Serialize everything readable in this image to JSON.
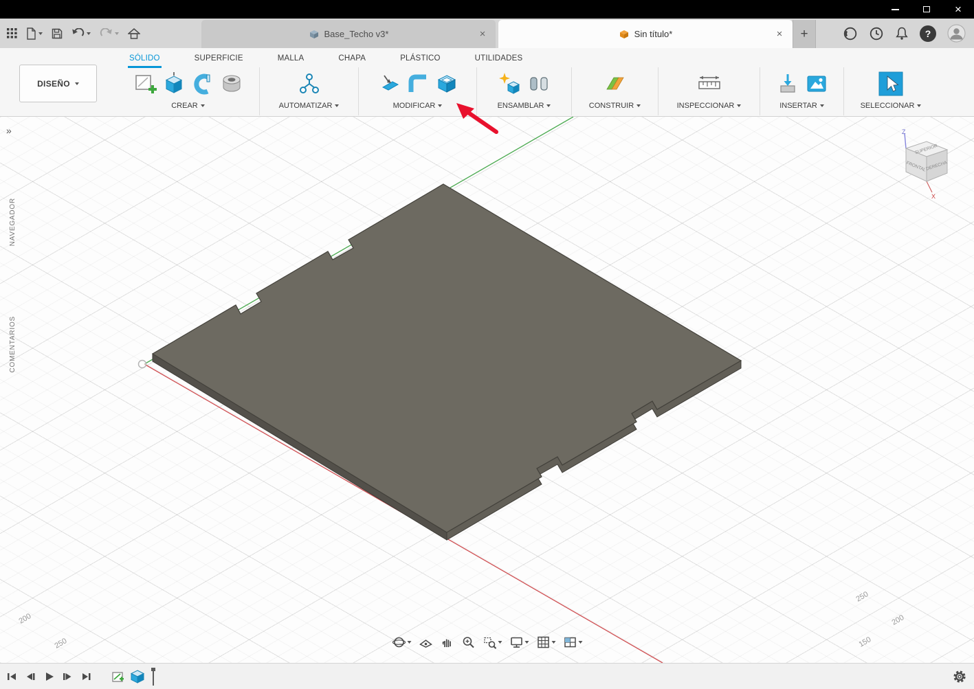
{
  "titlebar": {
    "close_icon": "×"
  },
  "tabstrip": {
    "documents": [
      {
        "label": "Base_Techo v3*",
        "active": false
      },
      {
        "label": "Sin título*",
        "active": true
      }
    ],
    "new_tab_label": "+",
    "close_tab_icon": "×"
  },
  "header_icons": {
    "help_glyph": "?"
  },
  "ribbon": {
    "workspace": {
      "label": "DISEÑO"
    },
    "env_tabs": [
      {
        "label": "SÓLIDO",
        "active": true
      },
      {
        "label": "SUPERFICIE",
        "active": false
      },
      {
        "label": "MALLA",
        "active": false
      },
      {
        "label": "CHAPA",
        "active": false
      },
      {
        "label": "PLÁSTICO",
        "active": false
      },
      {
        "label": "UTILIDADES",
        "active": false
      }
    ],
    "groups": [
      {
        "label": "CREAR"
      },
      {
        "label": "AUTOMATIZAR"
      },
      {
        "label": "MODIFICAR"
      },
      {
        "label": "ENSAMBLAR"
      },
      {
        "label": "CONSTRUIR"
      },
      {
        "label": "INSPECCIONAR"
      },
      {
        "label": "INSERTAR"
      },
      {
        "label": "SELECCIONAR"
      }
    ]
  },
  "left_rail": {
    "expand_icon": "»",
    "navigator_label": "NAVEGADOR",
    "comments_label": "COMENTARIOS"
  },
  "viewcube": {
    "top": "SUPERIOR",
    "front": "FRONTAL",
    "right": "DERECHA",
    "z": "Z",
    "x": "X"
  },
  "canvas": {
    "scale_labels": [
      "200",
      "250",
      "250",
      "200",
      "150"
    ]
  },
  "colors": {
    "accent_blue": "#0696d7",
    "arrow_red": "#e8112d",
    "axis_green": "#49a94e",
    "axis_red": "#cf4f52",
    "plate_top": "#6d6a61",
    "plate_side_left": "#53504a",
    "plate_side_right": "#605d56"
  }
}
